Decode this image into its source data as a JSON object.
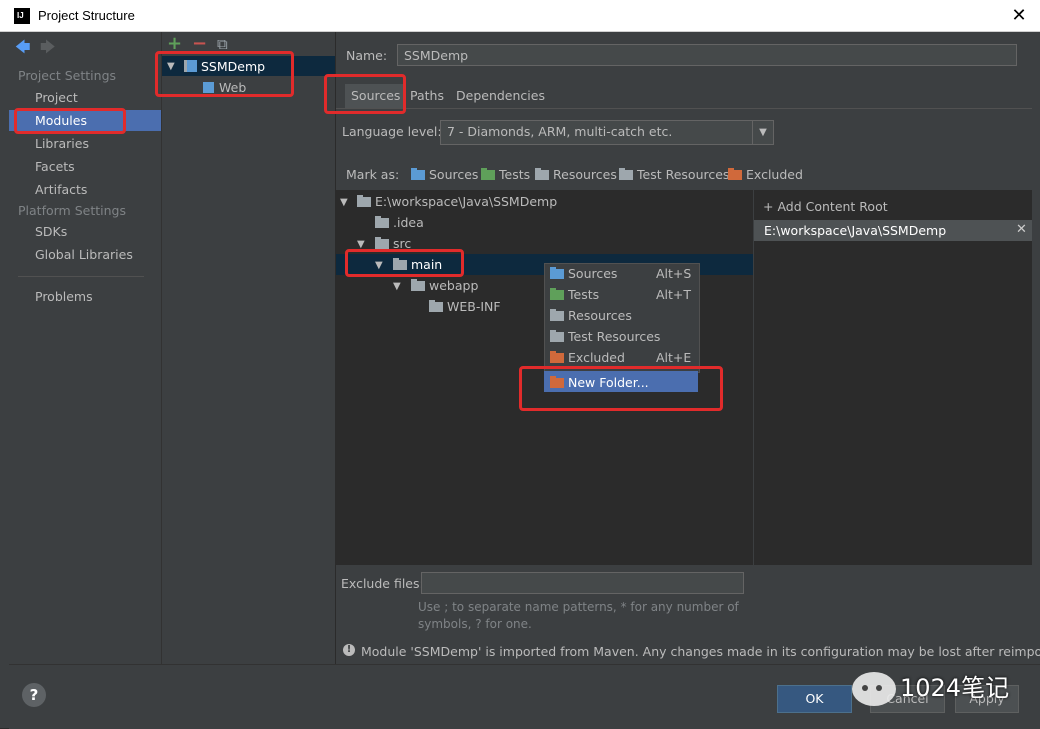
{
  "window": {
    "title": "Project Structure",
    "close_glyph": "✕"
  },
  "nav": {
    "back": "🡄",
    "forward": "🡆"
  },
  "sidebar": {
    "project_settings_header": "Project Settings",
    "project_settings": [
      "Project",
      "Modules",
      "Libraries",
      "Facets",
      "Artifacts"
    ],
    "platform_settings_header": "Platform Settings",
    "platform_settings": [
      "SDKs",
      "Global Libraries"
    ],
    "problems": "Problems",
    "selected": "Modules"
  },
  "modules_toolbar": {
    "add": "+",
    "remove": "−",
    "copy": "⧉"
  },
  "modules_tree": {
    "module": "SSMDemp",
    "facet": "Web"
  },
  "module_settings": {
    "name_label": "Name:",
    "name_value": "SSMDemp",
    "tabs": [
      "Sources",
      "Paths",
      "Dependencies"
    ],
    "active_tab": "Sources",
    "language_level_label": "Language level:",
    "language_level_value": "7 - Diamonds, ARM, multi-catch etc.",
    "mark_as_label": "Mark as:",
    "mark_as": [
      "Sources",
      "Tests",
      "Resources",
      "Test Resources",
      "Excluded"
    ],
    "add_content_root": "+ Add Content Root",
    "content_root": "E:\\workspace\\Java\\SSMDemp",
    "exclude_label": "Exclude files:",
    "exclude_value": "",
    "exclude_hint_line1": "Use ; to separate name patterns, * for any number of",
    "exclude_hint_line2": "symbols, ? for one.",
    "warning": "Module 'SSMDemp' is imported from Maven. Any changes made in its configuration may be lost after reimporting."
  },
  "source_tree": {
    "root": "E:\\workspace\\Java\\SSMDemp",
    "idea": ".idea",
    "src": "src",
    "main": "main",
    "webapp": "webapp",
    "webinf": "WEB-INF"
  },
  "context_menu": {
    "items": [
      {
        "label": "Sources",
        "shortcut": "Alt+S"
      },
      {
        "label": "Tests",
        "shortcut": "Alt+T"
      },
      {
        "label": "Resources",
        "shortcut": ""
      },
      {
        "label": "Test Resources",
        "shortcut": ""
      },
      {
        "label": "Excluded",
        "shortcut": "Alt+E"
      }
    ],
    "new_folder": "New Folder..."
  },
  "buttons": {
    "help": "?",
    "ok": "OK",
    "cancel": "Cancel",
    "apply": "Apply"
  },
  "watermark": {
    "text": "1024笔记"
  },
  "colors": {
    "selection": "#4b6eaf",
    "highlight_box": "#e12b2b",
    "sources": "#5b9bd5",
    "tests": "#5fa05a",
    "excluded": "#d0693b"
  }
}
